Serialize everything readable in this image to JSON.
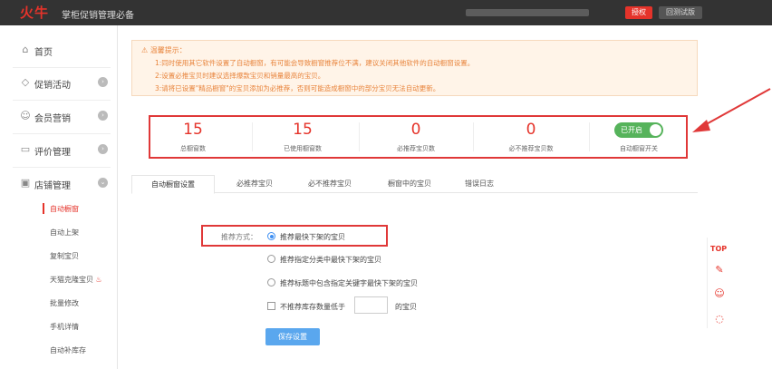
{
  "header": {
    "logo": "火牛",
    "title": "掌柜促销管理必备",
    "auth_button": "授权",
    "old_version_button": "回测试版"
  },
  "sidebar": {
    "items": [
      {
        "label": "首页",
        "icon": "home-icon"
      },
      {
        "label": "促销活动",
        "icon": "tag-icon"
      },
      {
        "label": "会员营销",
        "icon": "user-icon"
      },
      {
        "label": "评价管理",
        "icon": "comment-icon"
      },
      {
        "label": "店铺管理",
        "icon": "shop-icon"
      }
    ],
    "sub_items": [
      "自动橱窗",
      "自动上架",
      "复制宝贝",
      "天猫克隆宝贝",
      "批量修改",
      "手机详情",
      "自动补库存"
    ],
    "active_sub": "自动橱窗"
  },
  "notice": {
    "title": "温馨提示：",
    "lines": [
      "1:同时使用其它软件设置了自动橱窗，有可能会导致橱窗推荐位不满，建议关闭其他软件的自动橱窗设置。",
      "2:设置必推宝贝时建议选择爆款宝贝和销量最高的宝贝。",
      "3:请将已设置\"精品橱窗\"的宝贝添加为必推荐，否则可能造成橱窗中的部分宝贝无法自动更新。"
    ]
  },
  "stats": [
    {
      "value": "15",
      "label": "总橱窗数"
    },
    {
      "value": "15",
      "label": "已使用橱窗数"
    },
    {
      "value": "0",
      "label": "必推荐宝贝数"
    },
    {
      "value": "0",
      "label": "必不推荐宝贝数"
    }
  ],
  "toggle": {
    "state_label": "已开启",
    "label": "自动橱窗开关",
    "on": true
  },
  "tabs": [
    "自动橱窗设置",
    "必推荐宝贝",
    "必不推荐宝贝",
    "橱窗中的宝贝",
    "错误日志"
  ],
  "form": {
    "label": "推荐方式：",
    "options": [
      "推荐最快下架的宝贝",
      "推荐指定分类中最快下架的宝贝",
      "推荐标题中包含指定关键字最快下架的宝贝"
    ],
    "selected_index": 0,
    "stock_prefix": "不推荐库存数量低于",
    "stock_suffix": "的宝贝",
    "stock_value": "",
    "save_button": "保存设置"
  },
  "floatbar": {
    "top_label": "TOP"
  },
  "colors": {
    "accent": "#e5332a",
    "toggle_on": "#56b35b",
    "primary_button": "#5aa7ee",
    "notice_text": "#e8843c"
  }
}
